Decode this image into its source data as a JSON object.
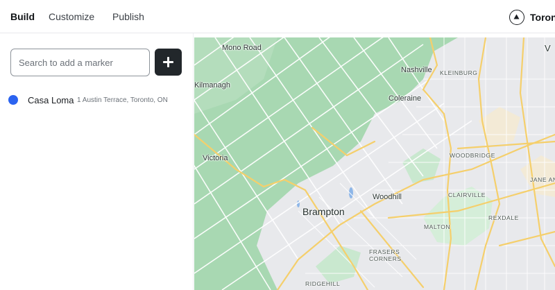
{
  "nav": {
    "tabs": [
      {
        "label": "Build",
        "active": true
      },
      {
        "label": "Customize",
        "active": false
      },
      {
        "label": "Publish",
        "active": false
      }
    ],
    "account": {
      "name": "Toron",
      "icon": "triangle-up-icon"
    }
  },
  "sidebar": {
    "search": {
      "placeholder": "Search to add a marker",
      "value": ""
    },
    "add_button_icon": "plus-icon",
    "markers": [
      {
        "name": "Casa Loma",
        "address": "1 Austin Terrace, Toronto, ON",
        "color": "#2b63f0"
      }
    ]
  },
  "map": {
    "labels": {
      "mono_road": "Mono Road",
      "nashville": "Nashville",
      "kleinburg": "KLEINBURG",
      "kilmanagh": "Kilmanagh",
      "coleraine": "Coleraine",
      "victoria": "Victoria",
      "woodbridge": "WOODBRIDGE",
      "jane_and_finch": "JANE AND",
      "woodhill": "Woodhill",
      "clairville": "CLAIRVILLE",
      "brampton": "Brampton",
      "rexdale": "REXDALE",
      "malton": "MALTON",
      "fraser_corners_1": "FRASERS",
      "fraser_corners_2": "CORNERS",
      "ridgehill": "RIDGEHILL",
      "v_label": "V"
    },
    "colors": {
      "park": "#a8d8b2",
      "urban": "#e9eaed",
      "road_major": "#f5cf6b",
      "road_minor": "#ffffff",
      "water": "#8db6e8"
    }
  }
}
